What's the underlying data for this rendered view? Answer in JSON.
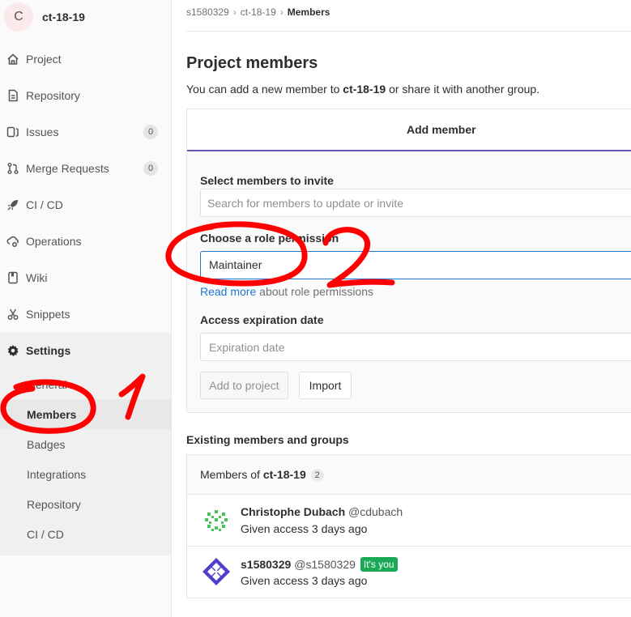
{
  "project": {
    "avatar_letter": "C",
    "name": "ct-18-19"
  },
  "sidebar": {
    "items": [
      {
        "label": "Project",
        "icon": "home-icon"
      },
      {
        "label": "Repository",
        "icon": "doc-icon"
      },
      {
        "label": "Issues",
        "icon": "issues-icon",
        "count": "0"
      },
      {
        "label": "Merge Requests",
        "icon": "merge-request-icon",
        "count": "0"
      },
      {
        "label": "CI / CD",
        "icon": "rocket-icon"
      },
      {
        "label": "Operations",
        "icon": "cloud-gear-icon"
      },
      {
        "label": "Wiki",
        "icon": "book-icon"
      },
      {
        "label": "Snippets",
        "icon": "scissors-icon"
      },
      {
        "label": "Settings",
        "icon": "gear-icon"
      }
    ],
    "settings_sub": [
      {
        "label": "General"
      },
      {
        "label": "Members"
      },
      {
        "label": "Badges"
      },
      {
        "label": "Integrations"
      },
      {
        "label": "Repository"
      },
      {
        "label": "CI / CD"
      }
    ]
  },
  "breadcrumb": {
    "items": [
      "s1580329",
      "ct-18-19",
      "Members"
    ],
    "separator": "›"
  },
  "page": {
    "title": "Project members",
    "intro_before": "You can add a new member to ",
    "intro_project": "ct-18-19",
    "intro_after": " or share it with another group."
  },
  "add_member": {
    "tab_label": "Add member",
    "select_label": "Select members to invite",
    "search_placeholder": "Search for members to update or invite",
    "role_label": "Choose a role permission",
    "role_value": "Maintainer",
    "help_link": "Read more",
    "help_after": " about role permissions",
    "expiration_label": "Access expiration date",
    "expiration_placeholder": "Expiration date",
    "add_button": "Add to project",
    "import_button": "Import"
  },
  "existing": {
    "title": "Existing members and groups",
    "header_prefix": "Members of ",
    "header_project": "ct-18-19",
    "count": "2",
    "members": [
      {
        "name": "Christophe Dubach",
        "username": "@cdubach",
        "meta": "Given access 3 days ago"
      },
      {
        "name": "s1580329",
        "username": "@s1580329",
        "badge": "It's you",
        "meta": "Given access 3 days ago"
      }
    ]
  },
  "colors": {
    "accent": "#6b4fbb",
    "link": "#1f78d1",
    "success": "#1aaa55",
    "annotation": "#ff0000"
  },
  "annotations": {
    "mark_1": "1",
    "mark_2": "2"
  }
}
